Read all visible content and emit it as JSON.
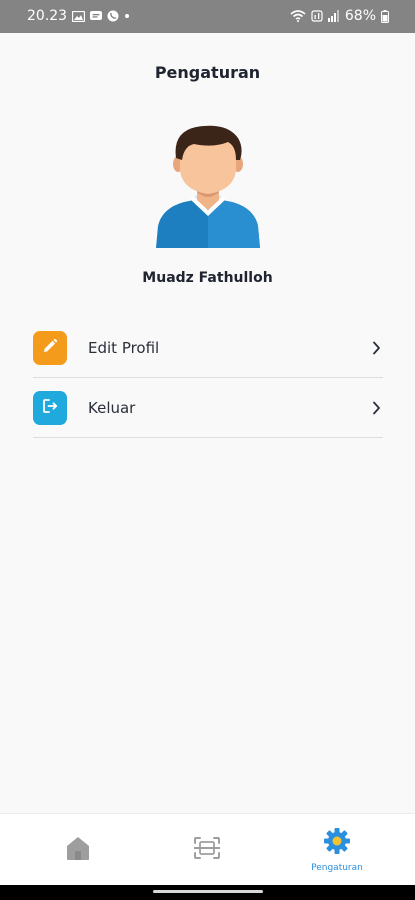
{
  "status_bar": {
    "time": "20.23",
    "battery": "68%",
    "icons_left": [
      "gallery-icon",
      "message-icon",
      "whatsapp-icon",
      "dot-icon"
    ],
    "icons_right": [
      "wifi-icon",
      "volte-icon",
      "signal-icon",
      "battery-icon"
    ]
  },
  "header": {
    "title": "Pengaturan"
  },
  "profile": {
    "name": "Muadz Fathulloh"
  },
  "menu": {
    "items": [
      {
        "label": "Edit Profil",
        "icon": "pencil-icon",
        "color": "#f59b1b"
      },
      {
        "label": "Keluar",
        "icon": "logout-icon",
        "color": "#1fa9dc"
      }
    ]
  },
  "bottom_nav": {
    "items": [
      {
        "icon": "home-icon",
        "label": "",
        "active": false
      },
      {
        "icon": "scan-icon",
        "label": "",
        "active": false
      },
      {
        "icon": "settings-icon",
        "label": "Pengaturan",
        "active": true
      }
    ],
    "active_color": "#2b8fe0",
    "inactive_color": "#9e9e9e"
  }
}
